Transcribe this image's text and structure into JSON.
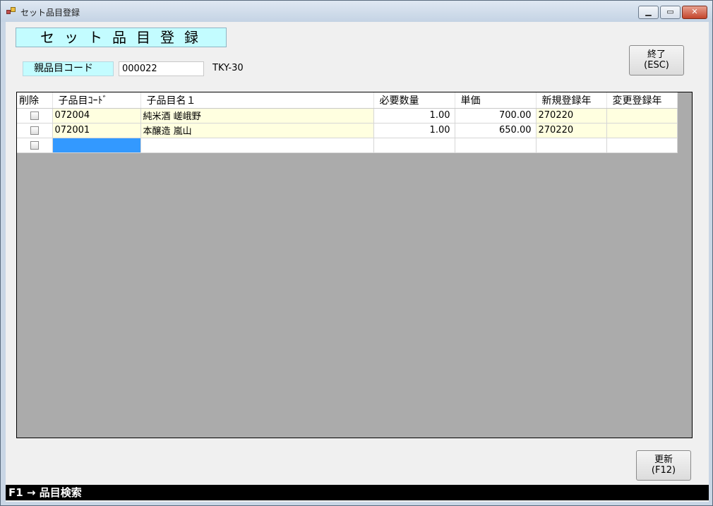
{
  "window": {
    "title": "セット品目登録",
    "minimize_glyph": "▁",
    "maximize_glyph": "▭",
    "close_glyph": "✕"
  },
  "form": {
    "heading": "セット品目登録",
    "parent_code_label": "親品目コード",
    "parent_code_value": "000022",
    "parent_name": "TKY-30"
  },
  "buttons": {
    "exit_line1": "終了",
    "exit_line2": "(ESC)",
    "update_line1": "更新",
    "update_line2": "(F12)"
  },
  "grid": {
    "columns": [
      "削除",
      "子品目ｺｰﾄﾞ",
      "子品目名１",
      "必要数量",
      "単価",
      "新規登録年",
      "変更登録年"
    ],
    "rows": [
      {
        "delete": false,
        "code": "072004",
        "name": "純米酒 嵯峨野",
        "qty": "1.00",
        "price": "700.00",
        "created": "270220",
        "modified": ""
      },
      {
        "delete": false,
        "code": "072001",
        "name": "本醸造 嵐山",
        "qty": "1.00",
        "price": "650.00",
        "created": "270220",
        "modified": ""
      }
    ]
  },
  "status": {
    "text": "F1 → 品目検索"
  },
  "colors": {
    "heading_bg": "#c3fcff",
    "row_bg": "#ffffe0",
    "selected_cell": "#3399ff",
    "grid_bg": "#ababab"
  }
}
